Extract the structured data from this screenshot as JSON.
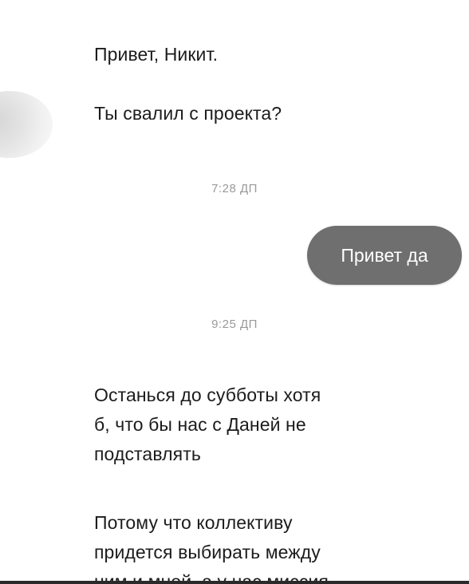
{
  "conversation": {
    "incoming_1": "Привет, Никит.",
    "incoming_2": "Ты свалил с проекта?",
    "time_1": "7:28 ДП",
    "outgoing_1": "Привет да",
    "time_2": "9:25 ДП",
    "incoming_3_line1": "Останься до субботы хотя",
    "incoming_3_line2": "б, что бы нас с Даней не",
    "incoming_3_line3": "подставлять",
    "incoming_4_line1": "Потому что коллективу",
    "incoming_4_line2": "придется выбирать между",
    "incoming_4_line3": "ним и мной, а у нас миссия"
  },
  "colors": {
    "outgoing_bubble": "#6f6f6f",
    "timestamp": "#9a9a9a",
    "text": "#1c1c1c"
  }
}
